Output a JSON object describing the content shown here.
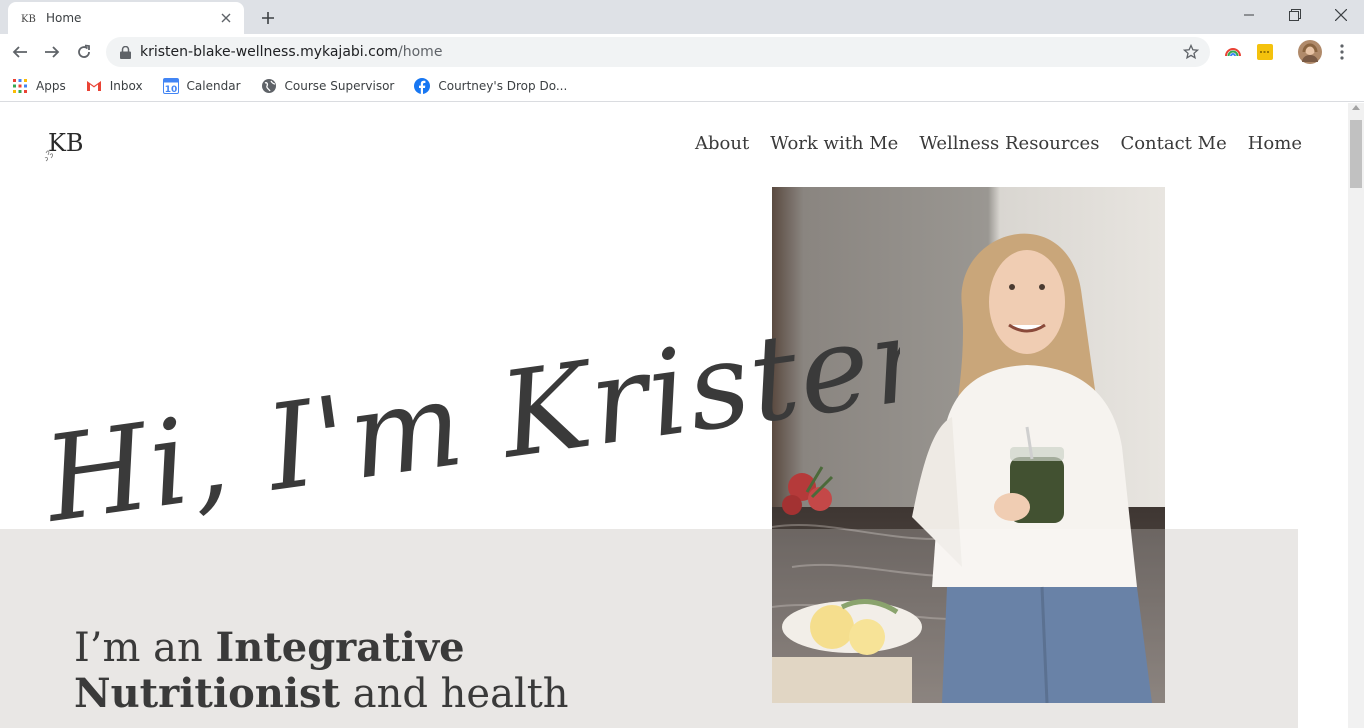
{
  "browser": {
    "tab_title": "Home",
    "url_domain": "kristen-blake-wellness.mykajabi.com",
    "url_path": "/home",
    "bookmarks": [
      {
        "label": "Apps",
        "icon": "apps-grid-icon"
      },
      {
        "label": "Inbox",
        "icon": "gmail-icon"
      },
      {
        "label": "Calendar",
        "icon": "calendar-icon"
      },
      {
        "label": "Course Supervisor",
        "icon": "globe-icon"
      },
      {
        "label": "Courtney's Drop Do...",
        "icon": "facebook-icon"
      }
    ],
    "calendar_icon_text": "10"
  },
  "site": {
    "logo_text": "KB",
    "nav": [
      "About",
      "Work with Me",
      "Wellness Resources",
      "Contact Me",
      "Home"
    ],
    "hero_heading": "Hi, I'm Kristen!",
    "intro_part1": "I’m an ",
    "intro_bold1": "Integrative Nutritionist",
    "intro_part2": " and health"
  },
  "colors": {
    "tabstrip": "#dee1e6",
    "omnibox": "#f1f3f4",
    "text_dark": "#3a3a3a",
    "band": "#e9e7e5"
  }
}
